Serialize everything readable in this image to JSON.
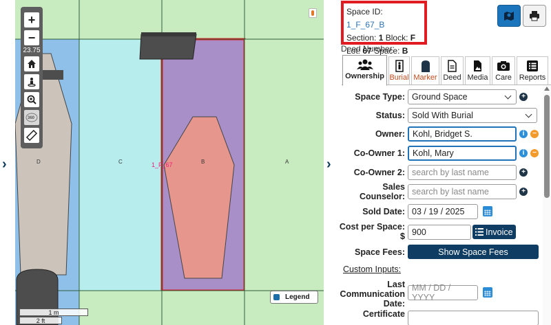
{
  "map": {
    "zoom_level": "23.75",
    "row_labels": [
      "D",
      "C",
      "B",
      "A"
    ],
    "selected_space_label": "1_F_67",
    "legend_label": "Legend",
    "scale_top": "1 m",
    "scale_bottom": "2 ft"
  },
  "info": {
    "space_id_label": "Space ID:",
    "space_id": "1_F_67_B",
    "section_label": "Section:",
    "section": "1",
    "block_label": "Block:",
    "block": "F",
    "lot_label": "Lot:",
    "lot": "67",
    "space_label": "Space:",
    "space": "B"
  },
  "deed_number_label": "Deed Number:",
  "tabs": [
    {
      "label": "Ownership",
      "icon": "users-icon"
    },
    {
      "label": "Burial",
      "icon": "burial-icon"
    },
    {
      "label": "Marker",
      "icon": "marker-icon"
    },
    {
      "label": "Deed",
      "icon": "document-icon"
    },
    {
      "label": "Media",
      "icon": "image-icon"
    },
    {
      "label": "Care",
      "icon": "camera-icon"
    },
    {
      "label": "Reports",
      "icon": "list-icon"
    }
  ],
  "form": {
    "space_type": {
      "label": "Space Type:",
      "value": "Ground Space"
    },
    "status": {
      "label": "Status:",
      "value": "Sold With Burial"
    },
    "owner": {
      "label": "Owner:",
      "value": "Kohl, Bridget S."
    },
    "co_owner_1": {
      "label": "Co-Owner 1:",
      "value": "Kohl, Mary"
    },
    "co_owner_2": {
      "label": "Co-Owner 2:",
      "placeholder": "search by last name"
    },
    "sales_counselor": {
      "label_line1": "Sales",
      "label_line2": "Counselor:",
      "placeholder": "search by last name"
    },
    "sold_date": {
      "label": "Sold Date:",
      "value": "03 / 19 / 2025"
    },
    "cost_per_space": {
      "label_line1": "Cost per Space:",
      "label_line2": "$",
      "value": "900",
      "invoice_label": "Invoice"
    },
    "space_fees": {
      "label": "Space Fees:",
      "button_label": "Show Space Fees"
    },
    "custom_inputs_label": "Custom Inputs:",
    "last_communication": {
      "label_line1": "Last",
      "label_line2": "Communication",
      "label_line3": "Date:",
      "placeholder": "MM / DD / YYYY"
    },
    "certificate": {
      "label": "Certificate"
    }
  },
  "colors": {
    "accent": "#0e3c62",
    "highlight_red": "#e11b22",
    "link_blue": "#2b73b8"
  }
}
